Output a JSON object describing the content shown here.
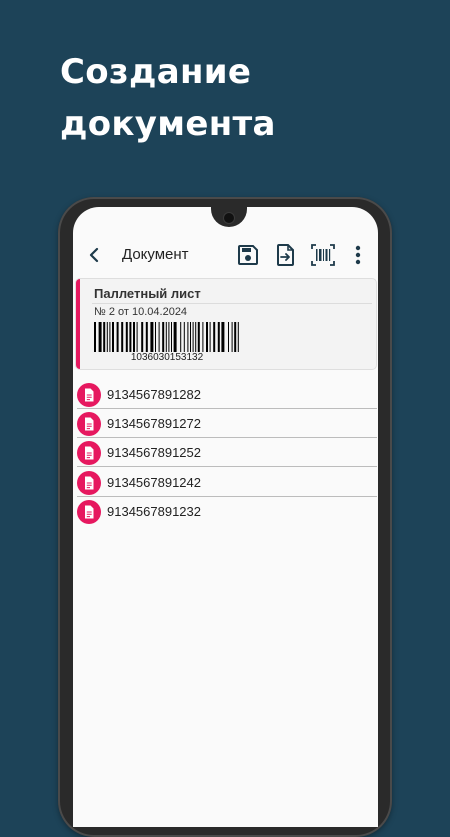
{
  "headline": {
    "line1": "Создание",
    "line2": "документа"
  },
  "appbar": {
    "title": "Документ",
    "back_icon": "arrow-back-icon",
    "actions": [
      "save-icon",
      "export-icon",
      "barcode-scan-icon",
      "more-vert-icon"
    ]
  },
  "document": {
    "title": "Паллетный лист",
    "subtitle": "№ 2 от 10.04.2024",
    "barcode": "1036030153132"
  },
  "items": [
    {
      "code": "9134567891282"
    },
    {
      "code": "9134567891272"
    },
    {
      "code": "9134567891252"
    },
    {
      "code": "9134567891242"
    },
    {
      "code": "9134567891232"
    }
  ],
  "colors": {
    "background": "#1d4358",
    "accent": "#e6185f",
    "icon": "#1e3a4a"
  }
}
